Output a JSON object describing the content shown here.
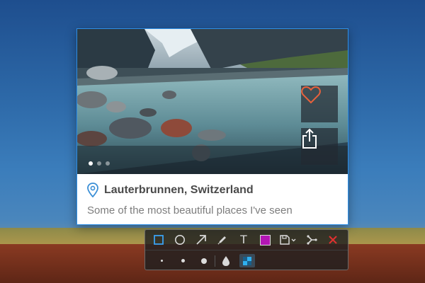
{
  "card": {
    "place_name": "Lauterbrunnen, Switzerland",
    "description": "Some of the most beautiful places I've seen",
    "carousel_dots": 3,
    "carousel_active_index": 0,
    "icons": {
      "location": "location-pin-icon",
      "favorite": "heart-icon",
      "share": "share-icon"
    },
    "colors": {
      "heart": "#e8613c",
      "pin": "#3b8fd6",
      "border": "#2e8fe6"
    }
  },
  "toolbar": {
    "tools": [
      {
        "name": "rectangle",
        "icon": "rectangle-icon",
        "active": true
      },
      {
        "name": "ellipse",
        "icon": "circle-icon"
      },
      {
        "name": "arrow",
        "icon": "arrow-icon"
      },
      {
        "name": "pen",
        "icon": "pencil-icon"
      },
      {
        "name": "text",
        "icon": "text-icon",
        "label": "T"
      },
      {
        "name": "color",
        "icon": "color-swatch",
        "color": "#b416b4"
      },
      {
        "name": "save",
        "icon": "save-icon"
      },
      {
        "name": "share",
        "icon": "share-nodes-icon"
      },
      {
        "name": "close",
        "icon": "close-icon",
        "color": "#e03030"
      }
    ],
    "sizes": [
      "small",
      "medium",
      "large"
    ],
    "extra_tools": [
      {
        "name": "blur",
        "icon": "droplet-icon"
      },
      {
        "name": "pixelate",
        "icon": "pixelate-icon",
        "active": true
      }
    ]
  }
}
